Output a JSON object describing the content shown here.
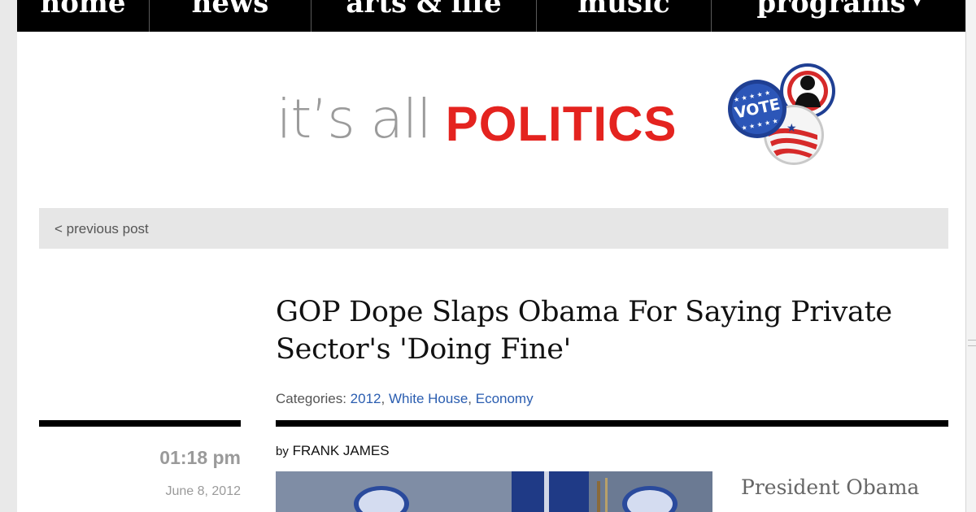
{
  "nav": {
    "items": [
      {
        "label": "home"
      },
      {
        "label": "news"
      },
      {
        "label": "arts & life"
      },
      {
        "label": "music"
      },
      {
        "label": "programs",
        "arrow": "▾"
      }
    ]
  },
  "brand": {
    "light_text": "it’s all",
    "bold_text": "POLITICS",
    "button_text": "VOTE"
  },
  "prev_post": {
    "label": "< previous post"
  },
  "article": {
    "headline": "GOP Dope Slaps Obama For Saying Private Sector's 'Doing Fine'",
    "categories_label": "Categories:",
    "categories": [
      "2012",
      "White House",
      "Economy"
    ],
    "byline_prefix": "by",
    "author": "FRANK JAMES",
    "time": "01:18 pm",
    "date": "June 8, 2012",
    "body_start": "President Obama"
  },
  "colors": {
    "nav_bg": "#000000",
    "brand_red": "#e4231f",
    "link_blue": "#2a5db0",
    "prev_bar_bg": "#e6e6e6"
  },
  "icons": [
    "vote-button-icon",
    "silhouette-button-icon",
    "flag-button-icon",
    "dropdown-arrow-icon"
  ]
}
